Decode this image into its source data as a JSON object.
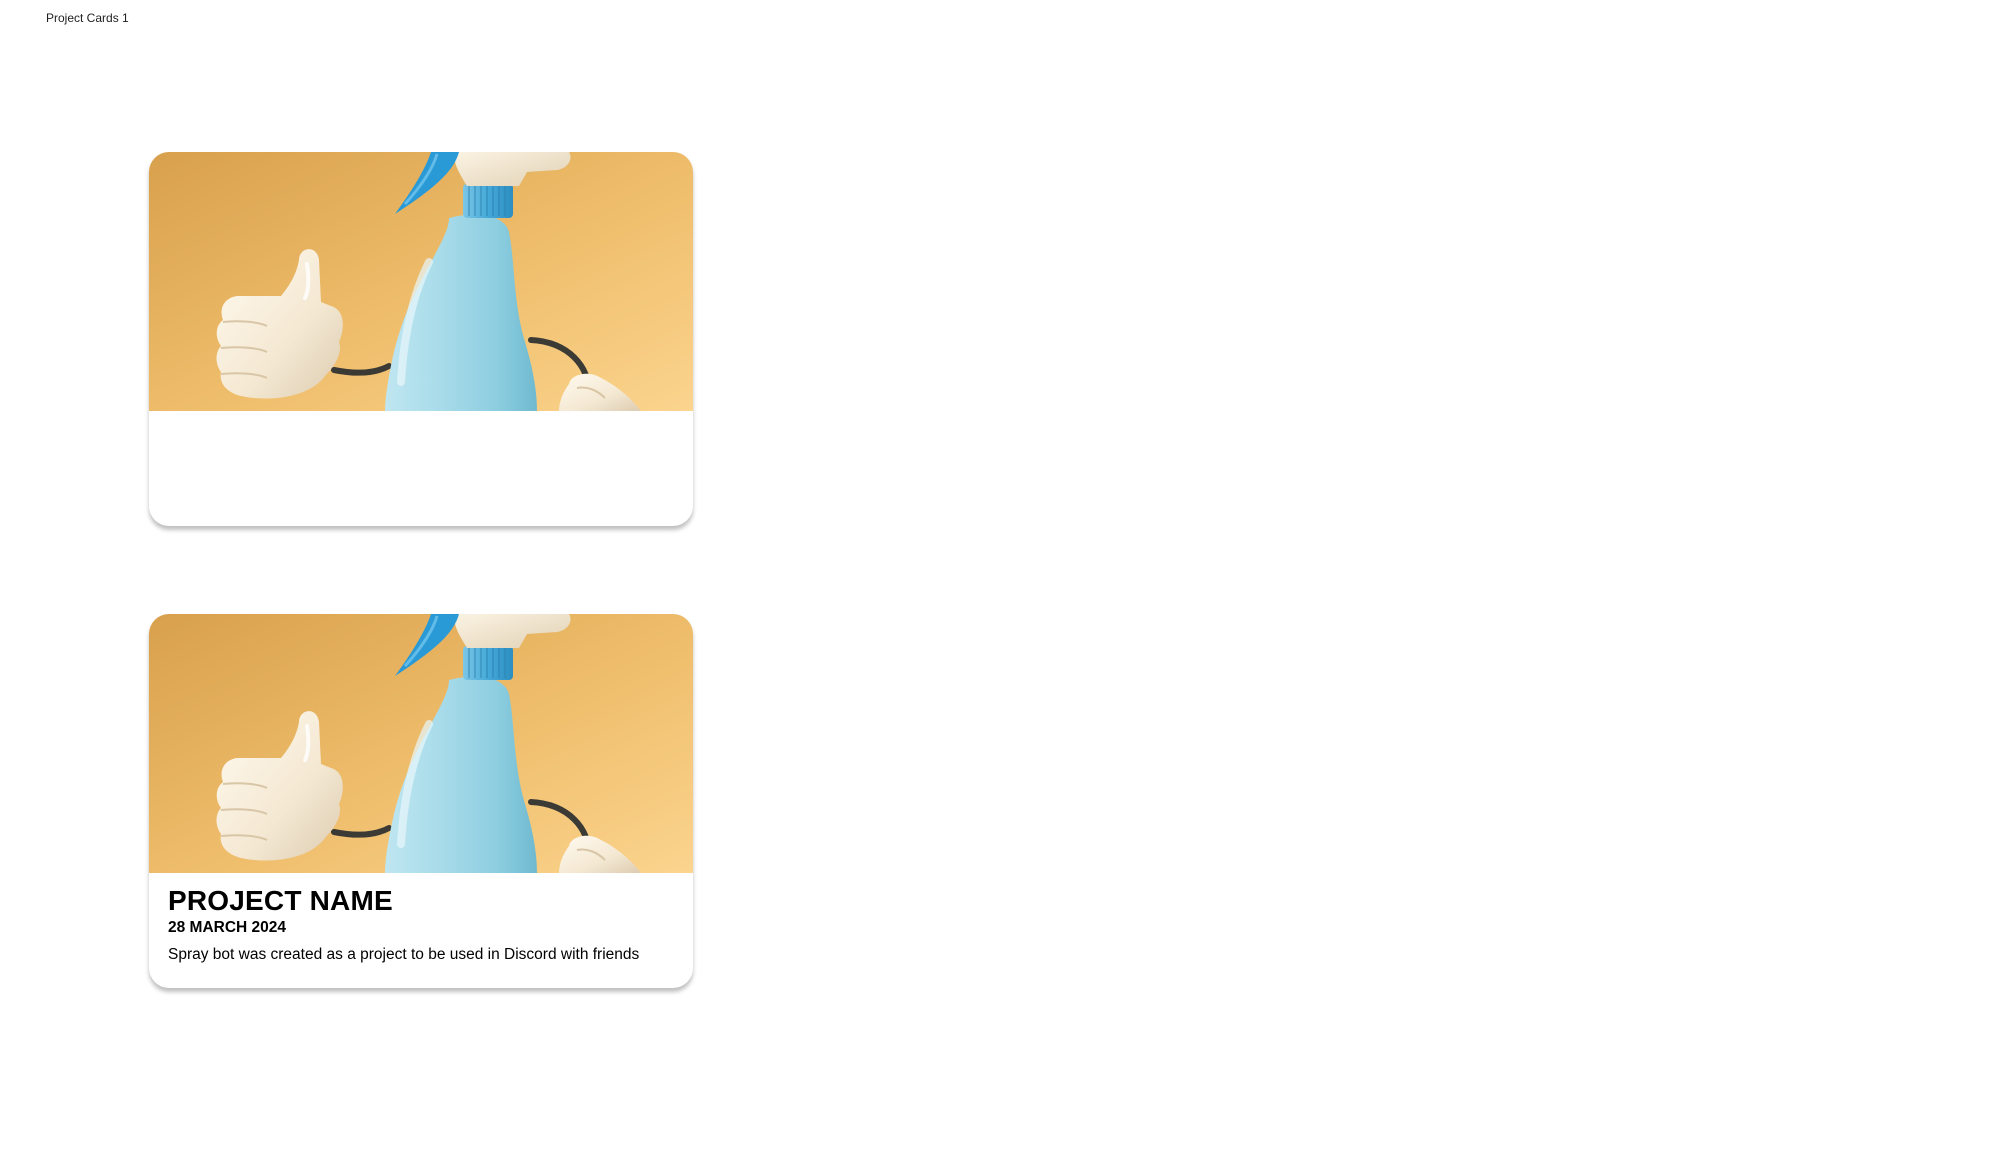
{
  "frame": {
    "label": "Project Cards 1"
  },
  "cards": [
    {
      "variant": "empty",
      "image_icon": "spray-bottle-thumbs-up-image",
      "colors": {
        "background_top": "#d7a04a",
        "background_bottom": "#fbd48c",
        "bottle": "#9fd3e3",
        "nozzle": "#2f9ed6"
      }
    },
    {
      "variant": "filled",
      "image_icon": "spray-bottle-thumbs-up-image",
      "title": "PROJECT NAME",
      "date": "28 MARCH 2024",
      "description": "Spray bot was created as a project to be used in Discord with friends"
    }
  ]
}
